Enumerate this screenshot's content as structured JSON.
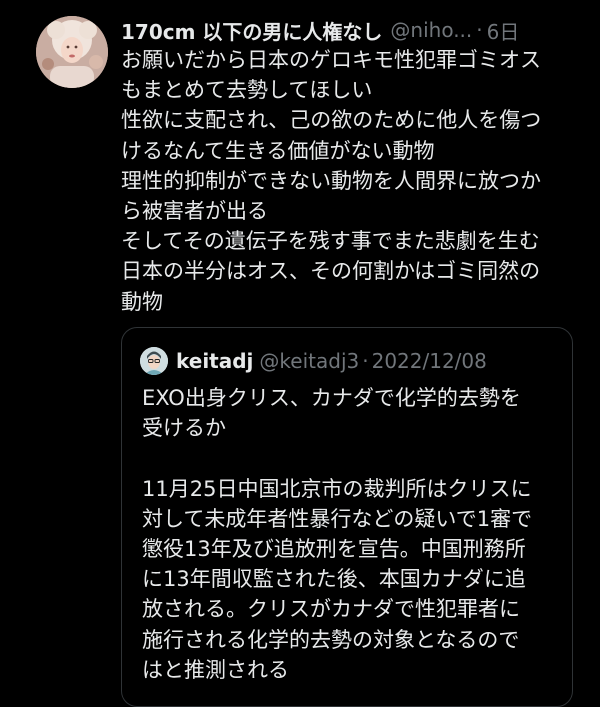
{
  "tweet": {
    "display_name": "170cm 以下の男に人権なし",
    "handle": "@niho...",
    "separator": "·",
    "time": "6日",
    "text": "お願いだから日本のゲロキモ性犯罪ゴミオス\nもまとめて去勢してほしい\n性欲に支配され、己の欲のために他人を傷つ\nけるなんて生きる価値がない動物\n理性的抑制ができない動物を人間界に放つか\nら被害者が出る\nそしてその遺伝子を残す事でまた悲劇を生む\n日本の半分はオス、その何割かはゴミ同然の\n動物"
  },
  "quote": {
    "display_name": "keitadj",
    "handle": "@keitadj3",
    "separator": "·",
    "date": "2022/12/08",
    "text": "EXO出身クリス、カナダで化学的去勢を\n受けるか\n\n11月25日中国北京市の裁判所はクリスに\n対して未成年者性暴行などの疑いで1審で\n懲役13年及び追放刑を宣告。中国刑務所\nに13年間収監された後、本国カナダに追\n放される。クリスがカナダで性犯罪者に\n施行される化学的去勢の対象となるので\nはと推測される"
  },
  "colors": {
    "background": "#000000",
    "text_primary": "#e7e9ea",
    "text_secondary": "#71767b",
    "border": "#2f3336"
  },
  "icons": {
    "avatar": "profile-avatar",
    "quote_avatar": "quote-profile-avatar"
  }
}
